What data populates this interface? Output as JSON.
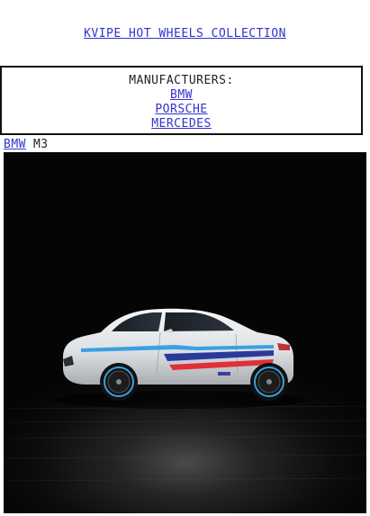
{
  "header": {
    "title": "KVIPE HOT WHEELS COLLECTION"
  },
  "manufacturers": {
    "heading": "MANUFACTURERS:",
    "items": [
      {
        "label": "BMW"
      },
      {
        "label": "PORSCHE"
      },
      {
        "label": "MERCEDES"
      }
    ]
  },
  "breadcrumb": {
    "manufacturer": "BMW",
    "model": "M3"
  },
  "photo": {
    "subject": "car-photo",
    "colors": {
      "background": "#050505",
      "body": "#e6e8ea",
      "stripe_light_blue": "#3aa0e0",
      "stripe_dark_blue": "#2a3a9a",
      "stripe_red": "#e0303a"
    }
  }
}
